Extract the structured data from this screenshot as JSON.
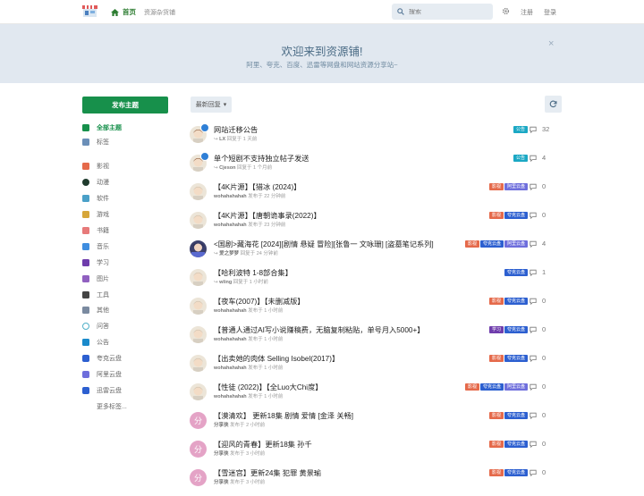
{
  "header": {
    "home_label": "首页",
    "site_name": "资源杂货铺",
    "search_placeholder": "搜索",
    "register_label": "注册",
    "login_label": "登录"
  },
  "hero": {
    "title": "欢迎来到资源铺!",
    "subtitle": "阿里、夸克、百度、迅雷等网盘和网站资源分享站~",
    "close_label": "×"
  },
  "sidebar": {
    "post_button": "发布主题",
    "items": [
      {
        "label": "全部主题",
        "icon": "chat-bubbles-icon",
        "color": "#17904b"
      },
      {
        "label": "标签",
        "icon": "tag-grid-icon",
        "color": "#6b8fb8"
      },
      {
        "label": "影视",
        "icon": "film-icon",
        "color": "#e56a4b"
      },
      {
        "label": "动漫",
        "icon": "play-circle-icon",
        "color": "#1f3b2d"
      },
      {
        "label": "软件",
        "icon": "grid-apps-icon",
        "color": "#4aa0c8"
      },
      {
        "label": "游戏",
        "icon": "gamepad-icon",
        "color": "#d6a63a"
      },
      {
        "label": "书籍",
        "icon": "book-icon",
        "color": "#e77a7a"
      },
      {
        "label": "音乐",
        "icon": "music-note-icon",
        "color": "#3f8ee0"
      },
      {
        "label": "学习",
        "icon": "graduation-cap-icon",
        "color": "#6f3dac"
      },
      {
        "label": "图片",
        "icon": "image-icon",
        "color": "#9060c0"
      },
      {
        "label": "工具",
        "icon": "tools-icon",
        "color": "#444"
      },
      {
        "label": "其他",
        "icon": "box-icon",
        "color": "#7a8aa0"
      },
      {
        "label": "问答",
        "icon": "question-icon",
        "color": "#50b0c8"
      },
      {
        "label": "公告",
        "icon": "megaphone-icon",
        "color": "#1a8acb"
      },
      {
        "label": "夸克云盘",
        "icon": "square-icon",
        "color": "#2c5fd0"
      },
      {
        "label": "阿里云盘",
        "icon": "square-icon",
        "color": "#6e6edc"
      },
      {
        "label": "迅雷云盘",
        "icon": "square-icon",
        "color": "#2c5fd0"
      },
      {
        "label": "更多标签...",
        "icon": "",
        "color": ""
      }
    ]
  },
  "toolbar": {
    "sort_label": "最新回复"
  },
  "threads": [
    {
      "title": "网站迁移公告",
      "meta_user": "LX",
      "meta_text": "回复于 1 天前",
      "replied": true,
      "avatar": "face",
      "badge": true,
      "tags": [
        {
          "t": "公告",
          "c": "#1ba8c4"
        }
      ],
      "count": "32"
    },
    {
      "title": "单个短剧不支持独立帖子发送",
      "meta_user": "Cjeson",
      "meta_text": "回复于 1 个月前",
      "replied": true,
      "avatar": "face",
      "badge": true,
      "tags": [
        {
          "t": "公告",
          "c": "#1ba8c4"
        }
      ],
      "count": "4"
    },
    {
      "title": "【4K片源】【猎冰 (2024)】",
      "meta_user": "wohahahahah",
      "meta_text": "发布于 22 分钟前",
      "replied": false,
      "avatar": "face2",
      "badge": false,
      "tags": [
        {
          "t": "影视",
          "c": "#e56a4b"
        },
        {
          "t": "阿里云盘",
          "c": "#6e6edc"
        }
      ],
      "count": "0"
    },
    {
      "title": "【4K片源】【唐朝诡事录(2022)】",
      "meta_user": "wohahahahah",
      "meta_text": "发布于 23 分钟前",
      "replied": false,
      "avatar": "face2",
      "badge": false,
      "tags": [
        {
          "t": "影视",
          "c": "#e56a4b"
        },
        {
          "t": "夸克云盘",
          "c": "#2c5fd0"
        }
      ],
      "count": "0"
    },
    {
      "title": "<国剧>藏海花 [2024][剧情 悬疑 冒险][张鲁一 文咏珊] [盗墓笔记系列]",
      "meta_user": "爱之梦梦",
      "meta_text": "回复于 24 分钟前",
      "replied": true,
      "avatar": "anime",
      "badge": false,
      "tags": [
        {
          "t": "影视",
          "c": "#e56a4b"
        },
        {
          "t": "夸克云盘",
          "c": "#2c5fd0"
        },
        {
          "t": "阿里云盘",
          "c": "#6e6edc"
        }
      ],
      "count": "4"
    },
    {
      "title": "【哈利波特 1-8部合集】",
      "meta_user": "wling",
      "meta_text": "回复于 1 小时前",
      "replied": true,
      "avatar": "face2",
      "badge": false,
      "tags": [
        {
          "t": "夸克云盘",
          "c": "#2c5fd0"
        }
      ],
      "count": "1"
    },
    {
      "title": "【夜车(2007)】【未删减版】",
      "meta_user": "wohahahahah",
      "meta_text": "发布于 1 小时前",
      "replied": false,
      "avatar": "face2",
      "badge": false,
      "tags": [
        {
          "t": "影视",
          "c": "#e56a4b"
        },
        {
          "t": "夸克云盘",
          "c": "#2c5fd0"
        }
      ],
      "count": "0"
    },
    {
      "title": "【普通人通过AI写小说赚稿费，无脑复制粘贴，单号月入5000+】",
      "meta_user": "wohahahahah",
      "meta_text": "发布于 1 小时前",
      "replied": false,
      "avatar": "face2",
      "badge": false,
      "tags": [
        {
          "t": "学习",
          "c": "#6f3dac"
        },
        {
          "t": "夸克云盘",
          "c": "#2c5fd0"
        }
      ],
      "count": "0"
    },
    {
      "title": "【出卖她的肉体 Selling Isobel(2017)】",
      "meta_user": "wohahahahah",
      "meta_text": "发布于 1 小时前",
      "replied": false,
      "avatar": "face2",
      "badge": false,
      "tags": [
        {
          "t": "影视",
          "c": "#e56a4b"
        },
        {
          "t": "夸克云盘",
          "c": "#2c5fd0"
        }
      ],
      "count": "0"
    },
    {
      "title": "【性徒 (2022)】【全Luo大Chi度】",
      "meta_user": "wohahahahah",
      "meta_text": "发布于 1 小时前",
      "replied": false,
      "avatar": "face2",
      "badge": false,
      "tags": [
        {
          "t": "影视",
          "c": "#e56a4b"
        },
        {
          "t": "夸克云盘",
          "c": "#2c5fd0"
        },
        {
          "t": "阿里云盘",
          "c": "#6e6edc"
        }
      ],
      "count": "0"
    },
    {
      "title": "【漠清欢】 更新18集 剧情 爱情 [金泽 关畅]",
      "meta_user": "分享侠",
      "meta_text": "发布于 2 小时前",
      "replied": false,
      "avatar": "letter",
      "badge": false,
      "tags": [
        {
          "t": "影视",
          "c": "#e56a4b"
        },
        {
          "t": "夸克云盘",
          "c": "#2c5fd0"
        }
      ],
      "count": "0"
    },
    {
      "title": "【迎风的青春】更新18集 孙千",
      "meta_user": "分享侠",
      "meta_text": "发布于 3 小时前",
      "replied": false,
      "avatar": "letter",
      "badge": false,
      "tags": [
        {
          "t": "影视",
          "c": "#e56a4b"
        },
        {
          "t": "夸克云盘",
          "c": "#2c5fd0"
        }
      ],
      "count": "0"
    },
    {
      "title": "【雪迷宫】更新24集 犯罪 黄景瑜",
      "meta_user": "分享侠",
      "meta_text": "发布于 3 小时前",
      "replied": false,
      "avatar": "letter",
      "badge": false,
      "tags": [
        {
          "t": "影视",
          "c": "#e56a4b"
        },
        {
          "t": "夸克云盘",
          "c": "#2c5fd0"
        }
      ],
      "count": "0"
    }
  ],
  "avatar_letter": "分"
}
